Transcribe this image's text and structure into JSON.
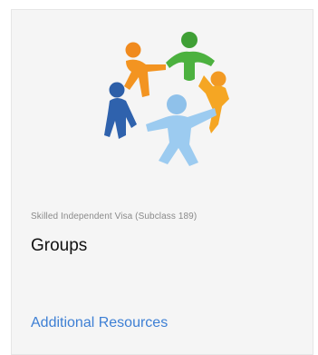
{
  "card": {
    "image": {
      "icon": "people-circle-icon",
      "colors": [
        "#3f9f35",
        "#f08a1e",
        "#f5a623",
        "#8fc1ea",
        "#2d5fa8"
      ]
    },
    "subtitle": "Skilled Independent Visa (Subclass 189)",
    "title": "Groups",
    "link_label": "Additional Resources",
    "link_color": "#3d7fd4"
  }
}
